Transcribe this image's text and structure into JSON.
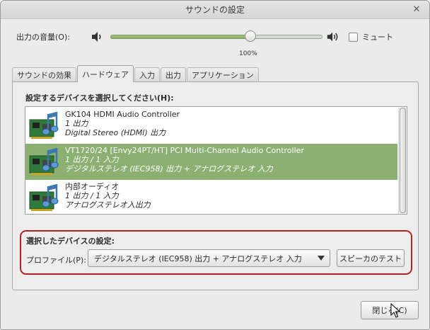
{
  "window": {
    "title": "サウンドの設定",
    "close_glyph": "✕"
  },
  "volume": {
    "label": "出力の音量(O):",
    "value_text": "100%",
    "level": 0.66,
    "mute_label": "ミュート",
    "muted": false
  },
  "tabs": [
    {
      "label": "サウンドの効果",
      "active": false
    },
    {
      "label": "ハードウェア",
      "active": true
    },
    {
      "label": "入力",
      "active": false
    },
    {
      "label": "出力",
      "active": false
    },
    {
      "label": "アプリケーション",
      "active": false
    }
  ],
  "hardware": {
    "select_label": "設定するデバイスを選択してください(H):",
    "devices": [
      {
        "name": "GK104 HDMI Audio Controller",
        "line2": "1 出力",
        "line3": "Digital Stereo (HDMI) 出力",
        "selected": false
      },
      {
        "name": "VT1720/24 [Envy24PT/HT] PCI Multi-Channel Audio Controller",
        "line2": "1 出力 / 1 入力",
        "line3": "デジタルステレオ (IEC958) 出力 + アナログステレオ 入力",
        "selected": true
      },
      {
        "name": "内部オーディオ",
        "line2": "1 出力 / 1 入力",
        "line3": "アナログステレオ入出力",
        "selected": false
      }
    ],
    "device_icon": "sound-card-icon"
  },
  "settings": {
    "title": "選択したデバイスの設定:",
    "profile_label": "プロファイル(P):",
    "profile_value": "デジタルステレオ (IEC958) 出力 + アナログステレオ 入力",
    "test_button": "スピーカのテスト"
  },
  "footer": {
    "close_button": "閉じる(C)"
  },
  "colors": {
    "selection": "#8bb072",
    "highlight_frame": "#b22222"
  }
}
